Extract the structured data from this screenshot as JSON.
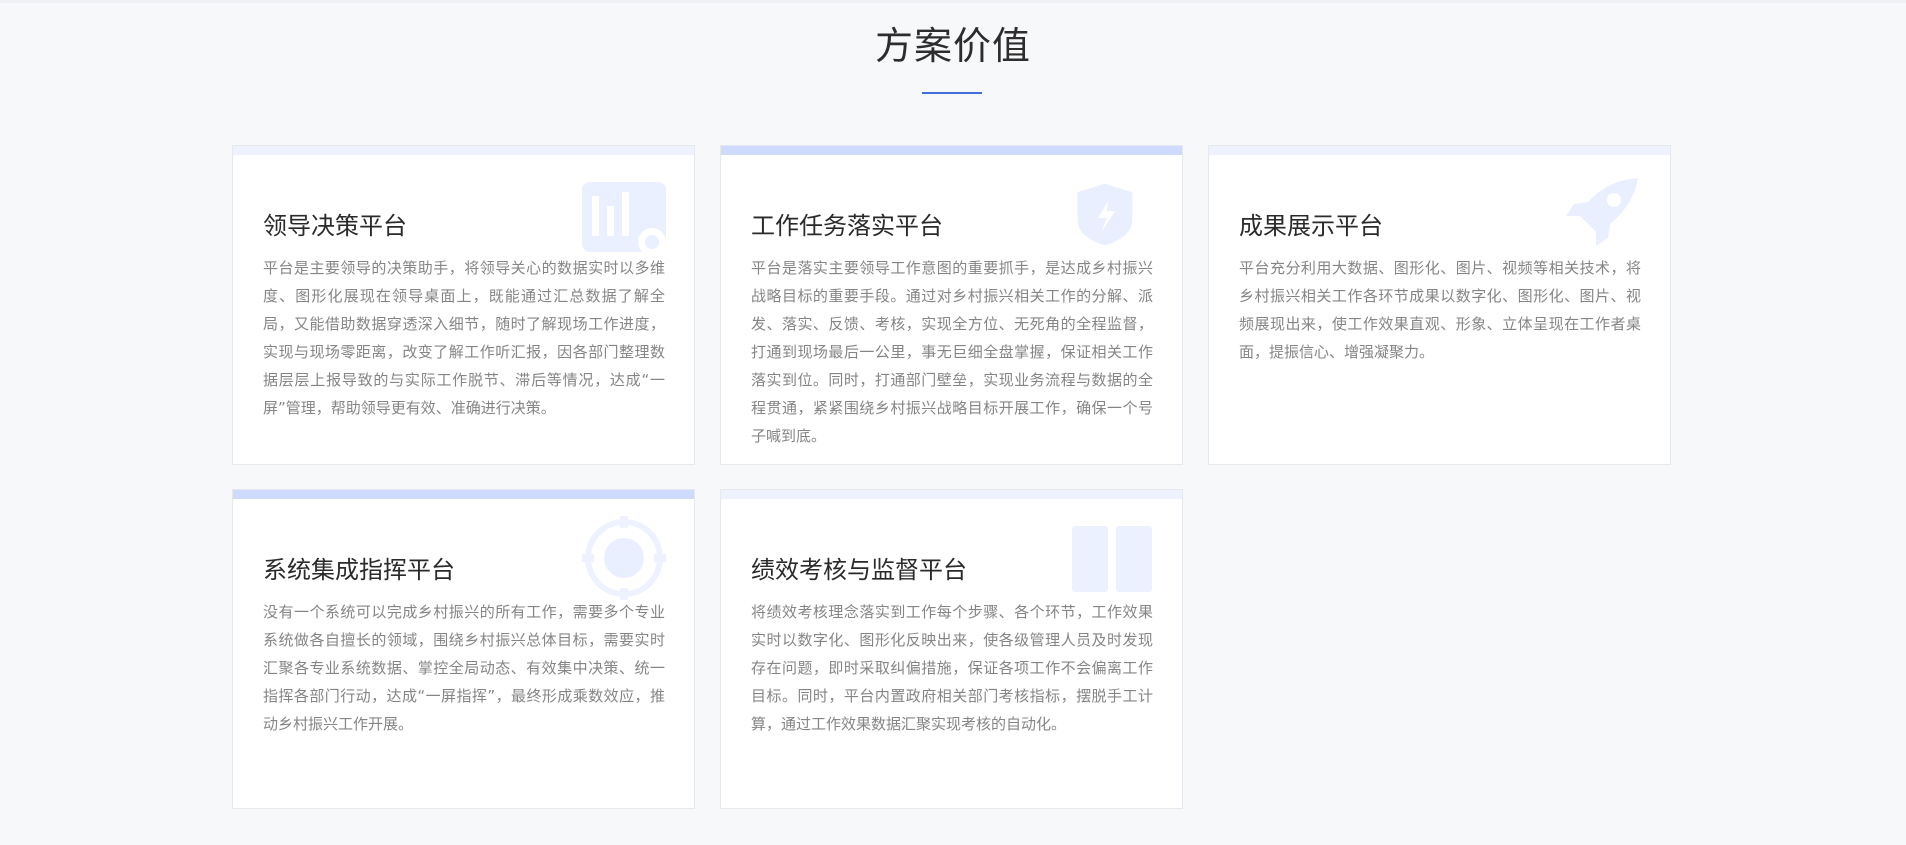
{
  "section": {
    "title": "方案价值"
  },
  "colors": {
    "accent": "#3f6fd8",
    "card_bar_light": "#eef2ff",
    "card_bar_strong": "#cfdaff",
    "deco": "#e8eeff"
  },
  "cards": [
    {
      "title": "领导决策平台",
      "icon": "chart-icon",
      "text": "平台是主要领导的决策助手，将领导关心的数据实时以多维度、图形化展现在领导桌面上，既能通过汇总数据了解全局，又能借助数据穿透深入细节，随时了解现场工作进度，实现与现场零距离，改变了解工作听汇报，因各部门整理数据层层上报导致的与实际工作脱节、滞后等情况，达成“一屏”管理，帮助领导更有效、准确进行决策。"
    },
    {
      "title": "工作任务落实平台",
      "icon": "shield-icon",
      "text": "平台是落实主要领导工作意图的重要抓手，是达成乡村振兴战略目标的重要手段。通过对乡村振兴相关工作的分解、派发、落实、反馈、考核，实现全方位、无死角的全程监督，打通到现场最后一公里，事无巨细全盘掌握，保证相关工作落实到位。同时，打通部门壁垒，实现业务流程与数据的全程贯通，紧紧围绕乡村振兴战略目标开展工作，确保一个号子喊到底。"
    },
    {
      "title": "成果展示平台",
      "icon": "rocket-icon",
      "text": "平台充分利用大数据、图形化、图片、视频等相关技术，将乡村振兴相关工作各环节成果以数字化、图形化、图片、视频展现出来，使工作效果直观、形象、立体呈现在工作者桌面，提振信心、增强凝聚力。"
    },
    {
      "title": "系统集成指挥平台",
      "icon": "target-icon",
      "text": "没有一个系统可以完成乡村振兴的所有工作，需要多个专业系统做各自擅长的领域，围绕乡村振兴总体目标，需要实时汇聚各专业系统数据、掌控全局动态、有效集中决策、统一指挥各部门行动，达成“一屏指挥”，最终形成乘数效应，推动乡村振兴工作开展。"
    },
    {
      "title": "绩效考核与监督平台",
      "icon": "book-icon",
      "text": "将绩效考核理念落实到工作每个步骤、各个环节，工作效果实时以数字化、图形化反映出来，使各级管理人员及时发现存在问题，即时采取纠偏措施，保证各项工作不会偏离工作目标。同时，平台内置政府相关部门考核指标，摆脱手工计算，通过工作效果数据汇聚实现考核的自动化。"
    }
  ]
}
